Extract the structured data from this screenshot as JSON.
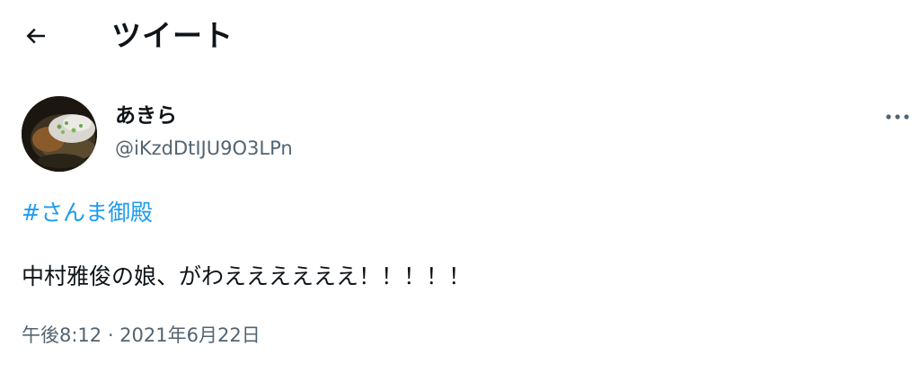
{
  "header": {
    "title": "ツイート",
    "back_icon": "arrow-left-icon"
  },
  "author": {
    "display_name": "あきら",
    "handle": "@iKzdDtIJU9O3LPn",
    "avatar_icon": "avatar-food-photo"
  },
  "more_icon": "more-horizontal-icon",
  "tweet": {
    "hashtag": "#さんま御殿",
    "text": "中村雅俊の娘、がわええええええ！！！！！",
    "meta": "午後8:12 · 2021年6月22日"
  },
  "colors": {
    "text": "#0f1419",
    "secondary": "#536471",
    "link": "#1d9bf0",
    "background": "#ffffff"
  }
}
